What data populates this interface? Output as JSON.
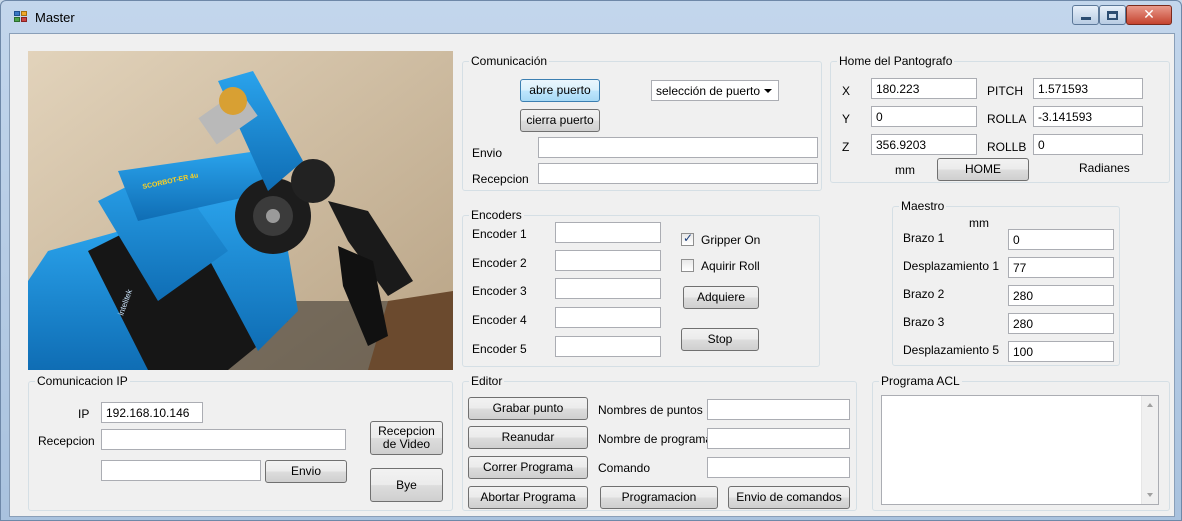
{
  "window": {
    "title": "Master"
  },
  "comunicacion": {
    "title": "Comunicación",
    "open_label": "abre puerto",
    "close_label": "cierra puerto",
    "port_selected": "selección de puerto",
    "envio_label": "Envio",
    "envio_value": "",
    "recepcion_label": "Recepcion",
    "recepcion_value": ""
  },
  "home": {
    "title": "Home del Pantografo",
    "x_label": "X",
    "x_value": "180.223",
    "y_label": "Y",
    "y_value": "0",
    "z_label": "Z",
    "z_value": "356.9203",
    "pitch_label": "PITCH",
    "pitch_value": "1.571593",
    "rolla_label": "ROLLA",
    "rolla_value": "-3.141593",
    "rollb_label": "ROLLB",
    "rollb_value": "0",
    "mm_label": "mm",
    "home_button": "HOME",
    "radianes_label": "Radianes"
  },
  "encoders": {
    "title": "Encoders",
    "items": [
      {
        "label": "Encoder 1",
        "value": ""
      },
      {
        "label": "Encoder 2",
        "value": ""
      },
      {
        "label": "Encoder 3",
        "value": ""
      },
      {
        "label": "Encoder 4",
        "value": ""
      },
      {
        "label": "Encoder 5",
        "value": ""
      }
    ],
    "gripper_label": "Gripper On",
    "gripper_checked": true,
    "aquirir_label": "Aquirir Roll",
    "aquirir_checked": false,
    "adquiere_button": "Adquiere",
    "stop_button": "Stop"
  },
  "maestro": {
    "title": "Maestro",
    "mm_label": "mm",
    "brazo1_label": "Brazo 1",
    "brazo1_value": "0",
    "desp1_label": "Desplazamiento 1",
    "desp1_value": "77",
    "brazo2_label": "Brazo 2",
    "brazo2_value": "280",
    "brazo3_label": "Brazo 3",
    "brazo3_value": "280",
    "desp5_label": "Desplazamiento 5",
    "desp5_value": "100"
  },
  "ip": {
    "title": "Comunicacion IP",
    "ip_label": "IP",
    "ip_value": "192.168.10.146",
    "recepcion_label": "Recepcion",
    "recepcion_value": "",
    "envio_value": "",
    "envio_button": "Envio",
    "video_button_line1": "Recepcion",
    "video_button_line2": "de Video",
    "bye_button": "Bye"
  },
  "editor": {
    "title": "Editor",
    "grabar_button": "Grabar punto",
    "reanudar_button": "Reanudar",
    "correr_button": "Correr Programa",
    "abortar_button": "Abortar Programa",
    "nombres_puntos_label": "Nombres de puntos",
    "nombres_puntos_value": "",
    "nombre_programa_label": "Nombre de programa",
    "nombre_programa_value": "",
    "comando_label": "Comando",
    "comando_value": "",
    "programacion_button": "Programacion",
    "envio_comandos_button": "Envio de comandos"
  },
  "programa_acl": {
    "title": "Programa ACL",
    "content": ""
  },
  "photo": {
    "robot_label": "SCORBOT-ER 4u",
    "brand_label": "intelitek"
  },
  "colors": {
    "robot_blue": "#1a8fd6",
    "wall": "#d8c7ad",
    "photo_bg": "#3f3a33"
  }
}
